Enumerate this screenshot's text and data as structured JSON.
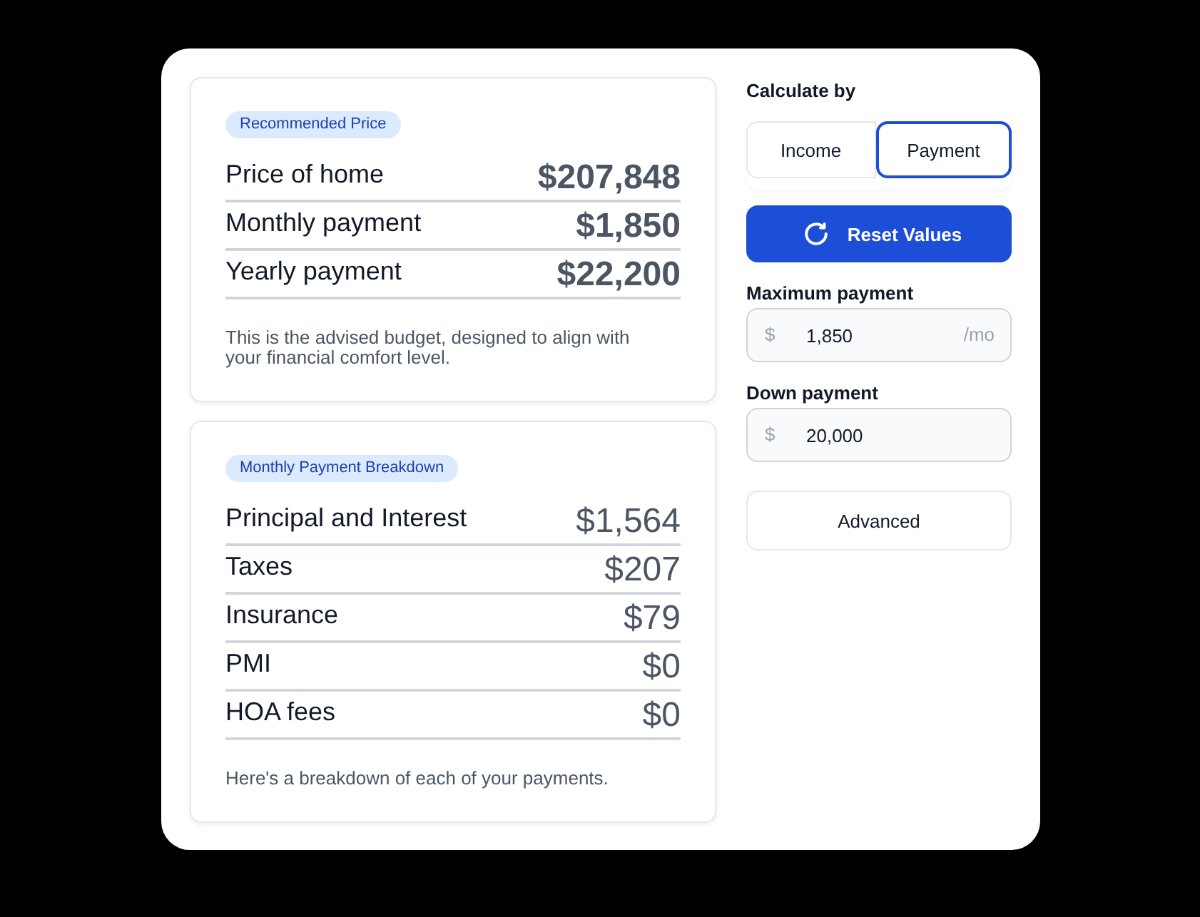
{
  "cards": [
    {
      "kind": "summary",
      "badge": "Recommended Price",
      "rows": [
        {
          "label": "Price of home",
          "value": "$207,848"
        },
        {
          "label": "Monthly payment",
          "value": "$1,850"
        },
        {
          "label": "Yearly payment",
          "value": "$22,200"
        }
      ],
      "note": "This is the advised budget, designed to align with your financial comfort level."
    },
    {
      "kind": "breakdown",
      "badge": "Monthly Payment Breakdown",
      "rows": [
        {
          "label": "Principal and Interest",
          "value": "$1,564"
        },
        {
          "label": "Taxes",
          "value": "$207"
        },
        {
          "label": "Insurance",
          "value": "$79"
        },
        {
          "label": "PMI",
          "value": "$0"
        },
        {
          "label": "HOA fees",
          "value": "$0"
        }
      ],
      "note": "Here's a breakdown of each of your payments."
    }
  ],
  "calculate_by": {
    "label": "Calculate by",
    "options": [
      {
        "label": "Income",
        "selected": false
      },
      {
        "label": "Payment",
        "selected": true
      }
    ]
  },
  "reset_button": "Reset Values",
  "fields": [
    {
      "label": "Maximum payment",
      "prefix": "$",
      "value": "1,850",
      "suffix": "/mo"
    },
    {
      "label": "Down payment",
      "prefix": "$",
      "value": "20,000"
    }
  ],
  "advanced_button": "Advanced"
}
